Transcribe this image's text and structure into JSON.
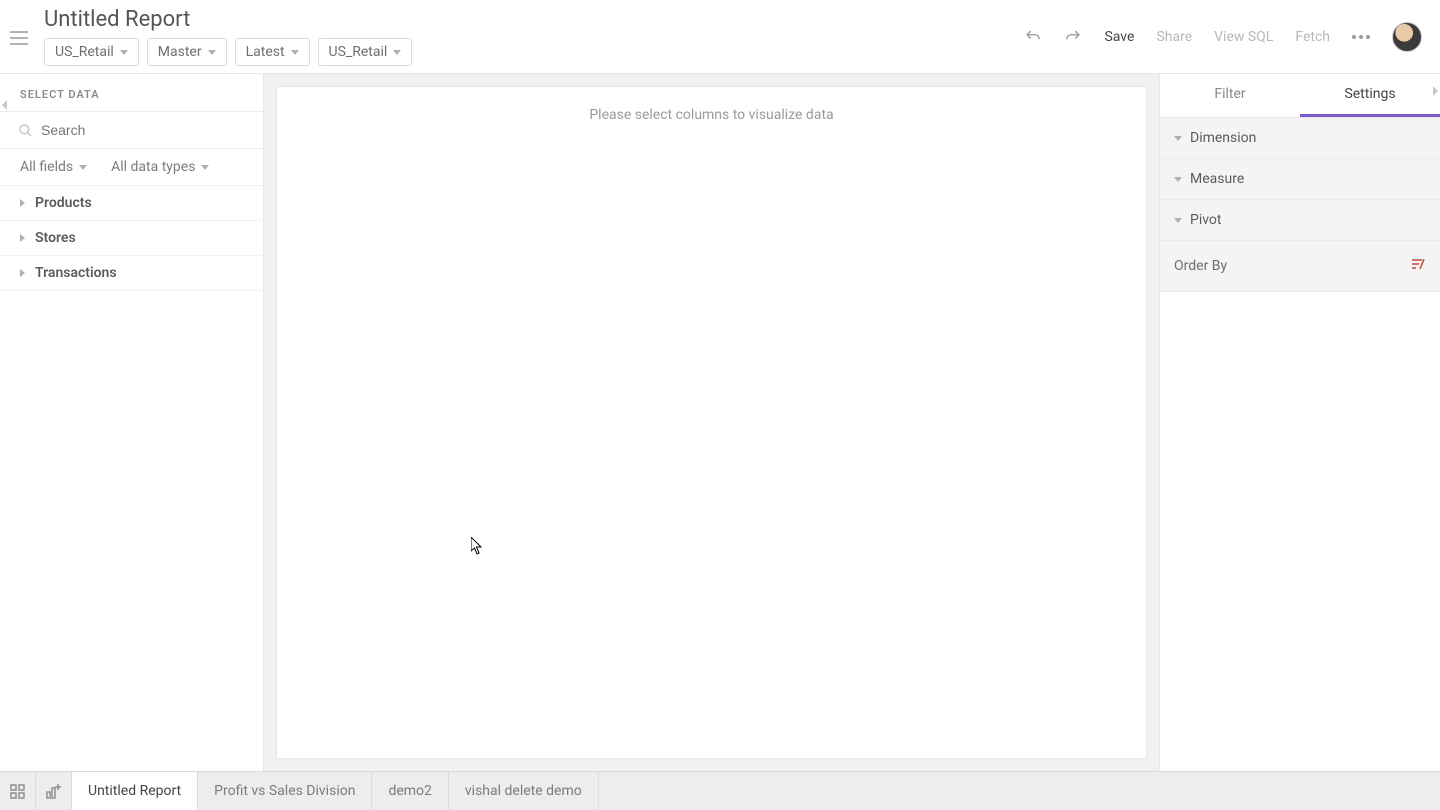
{
  "header": {
    "title": "Untitled Report",
    "selectors": [
      "US_Retail",
      "Master",
      "Latest",
      "US_Retail"
    ],
    "actions": {
      "save": "Save",
      "share": "Share",
      "viewSql": "View SQL",
      "fetch": "Fetch"
    }
  },
  "leftPanel": {
    "heading": "SELECT DATA",
    "searchPlaceholder": "Search",
    "filterFields": "All fields",
    "filterTypes": "All data types",
    "tree": [
      "Products",
      "Stores",
      "Transactions"
    ]
  },
  "canvas": {
    "placeholder": "Please select columns to visualize data"
  },
  "rightPanel": {
    "tabs": {
      "filter": "Filter",
      "settings": "Settings"
    },
    "sections": [
      "Dimension",
      "Measure",
      "Pivot"
    ],
    "orderBy": "Order By"
  },
  "bottomTabs": [
    "Untitled Report",
    "Profit vs Sales Division",
    "demo2",
    "vishal delete demo"
  ]
}
